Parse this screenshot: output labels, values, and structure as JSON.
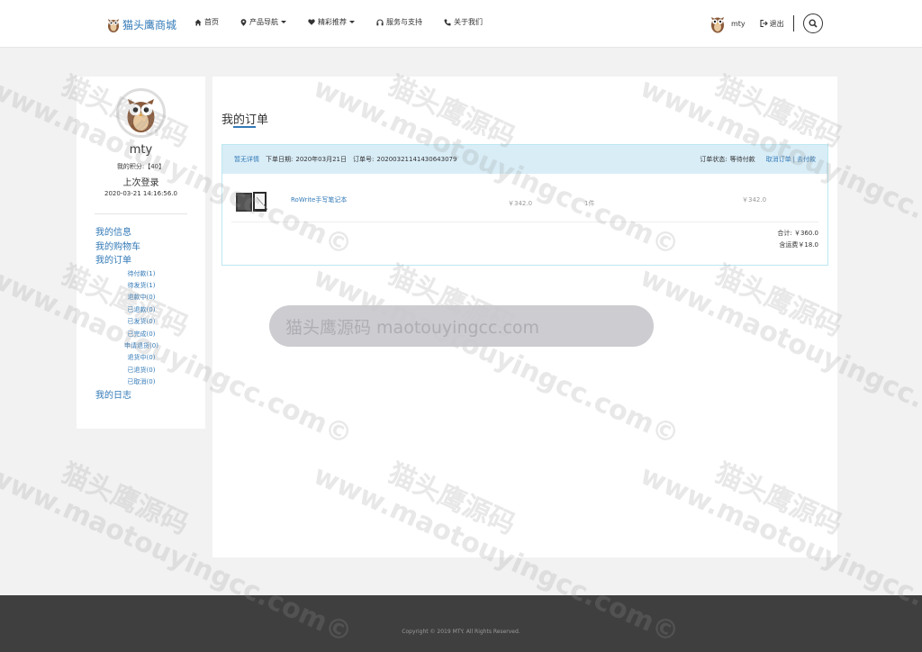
{
  "header": {
    "brand": "猫头鹰商城",
    "nav": [
      {
        "label": "首页",
        "icon": "home-icon",
        "dropdown": false
      },
      {
        "label": "产品导航",
        "icon": "map-marker-icon",
        "dropdown": true
      },
      {
        "label": "精彩推荐",
        "icon": "heart-icon",
        "dropdown": true
      },
      {
        "label": "服务与支持",
        "icon": "headphones-icon",
        "dropdown": false
      },
      {
        "label": "关于我们",
        "icon": "phone-icon",
        "dropdown": false
      }
    ],
    "username": "mty",
    "logout": "退出"
  },
  "sidebar": {
    "username": "mty",
    "points": "我的积分:【40】",
    "last_login_label": "上次登录",
    "last_login_time": "2020-03-21 14:16:56.0",
    "menu": {
      "info": "我的信息",
      "cart": "我的购物车",
      "orders": "我的订单",
      "sub": [
        "待付款(1)",
        "待发货(1)",
        "退款中(0)",
        "已退款(0)",
        "已发货(0)",
        "已完成(0)",
        "申请退货(0)",
        "退货中(0)",
        "已退货(0)",
        "已取消(0)"
      ],
      "log": "我的日志"
    }
  },
  "main": {
    "title": "我的订单",
    "order": {
      "detail_link": "暂无详情",
      "date_label": "下单日期:",
      "date": "2020年03月21日",
      "no_label": "订单号:",
      "no": "20200321141430643079",
      "status_label": "订单状态:",
      "status": "等待付款",
      "cancel": "取消订单",
      "divider": "|",
      "pay": "去付款",
      "item": {
        "name": "RoWrite手写笔记本",
        "price": "￥342.0",
        "qty": "1件",
        "subtotal": "￥342.0"
      },
      "total": "合计: ￥360.0",
      "shipping": "含运费￥18.0"
    }
  },
  "banner": "猫头鹰源码 maotouyingcc.com",
  "watermark": {
    "cn": "猫头鹰源码",
    "en": "www.maotouyingcc.com©"
  },
  "footer": {
    "copyright": "Copyright © 2019 MTY. All Rights Reserved."
  }
}
